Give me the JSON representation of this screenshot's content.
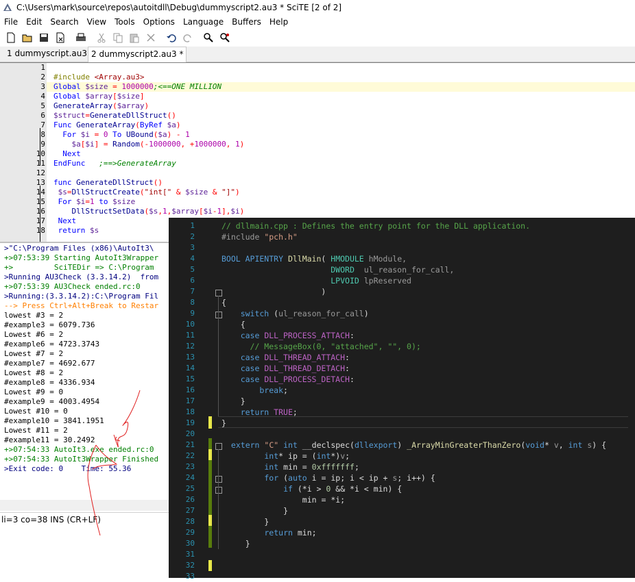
{
  "window": {
    "title": "C:\\Users\\mark\\source\\repos\\autoitdll\\Debug\\dummyscript2.au3 * SciTE [2 of 2]"
  },
  "menu": [
    "File",
    "Edit",
    "Search",
    "View",
    "Tools",
    "Options",
    "Language",
    "Buffers",
    "Help"
  ],
  "toolbar": [
    "new-file-icon",
    "open-folder-icon",
    "save-icon",
    "close-file-icon",
    "print-icon",
    "cut-icon",
    "copy-icon",
    "paste-icon",
    "delete-icon",
    "undo-icon",
    "redo-icon",
    "find-icon",
    "replace-icon"
  ],
  "tabs": [
    {
      "label": "1 dummyscript.au3 *"
    },
    {
      "label": "2 dummyscript2.au3 *"
    }
  ],
  "editor": {
    "line_numbers": [
      "1",
      "2",
      "3",
      "4",
      "5",
      "6",
      "7",
      "8",
      "9",
      "10",
      "11",
      "12",
      "13",
      "14",
      "15",
      "16",
      "17",
      "18"
    ],
    "lines": [
      [],
      [
        {
          "c": "mac",
          "t": "#include "
        },
        {
          "c": "str",
          "t": "<Array.au3>"
        }
      ],
      [
        {
          "c": "kw",
          "t": "Global "
        },
        {
          "c": "var",
          "t": "$size"
        },
        {
          "c": "op",
          "t": " = "
        },
        {
          "c": "num",
          "t": "1000000"
        },
        {
          "c": "cm",
          "t": ";<==ONE MILLION"
        }
      ],
      [
        {
          "c": "kw",
          "t": "Global "
        },
        {
          "c": "var",
          "t": "$array"
        },
        {
          "c": "op",
          "t": "["
        },
        {
          "c": "var",
          "t": "$size"
        },
        {
          "c": "op",
          "t": "]"
        }
      ],
      [
        {
          "c": "fn",
          "t": "GenerateArray"
        },
        {
          "c": "op",
          "t": "("
        },
        {
          "c": "var",
          "t": "$array"
        },
        {
          "c": "op",
          "t": ")"
        }
      ],
      [
        {
          "c": "var",
          "t": "$struct"
        },
        {
          "c": "op",
          "t": "="
        },
        {
          "c": "fn",
          "t": "GenerateDllStruct"
        },
        {
          "c": "op",
          "t": "()"
        }
      ],
      [
        {
          "c": "kw",
          "t": "Func "
        },
        {
          "c": "fn",
          "t": "GenerateArray"
        },
        {
          "c": "op",
          "t": "("
        },
        {
          "c": "kw",
          "t": "ByRef "
        },
        {
          "c": "var",
          "t": "$a"
        },
        {
          "c": "op",
          "t": ")"
        }
      ],
      [
        {
          "c": "kw",
          "t": "  For "
        },
        {
          "c": "var",
          "t": "$i"
        },
        {
          "c": "op",
          "t": " = "
        },
        {
          "c": "num",
          "t": "0"
        },
        {
          "c": "kw",
          "t": " To "
        },
        {
          "c": "fn",
          "t": "UBound"
        },
        {
          "c": "op",
          "t": "("
        },
        {
          "c": "var",
          "t": "$a"
        },
        {
          "c": "op",
          "t": ") - "
        },
        {
          "c": "num",
          "t": "1"
        }
      ],
      [
        {
          "c": "var",
          "t": "    $a"
        },
        {
          "c": "op",
          "t": "["
        },
        {
          "c": "var",
          "t": "$i"
        },
        {
          "c": "op",
          "t": "] = "
        },
        {
          "c": "fn",
          "t": "Random"
        },
        {
          "c": "op",
          "t": "(-"
        },
        {
          "c": "num",
          "t": "1000000"
        },
        {
          "c": "op",
          "t": ", +"
        },
        {
          "c": "num",
          "t": "1000000"
        },
        {
          "c": "op",
          "t": ", "
        },
        {
          "c": "num",
          "t": "1"
        },
        {
          "c": "op",
          "t": ")"
        }
      ],
      [
        {
          "c": "kw",
          "t": "  Next"
        }
      ],
      [
        {
          "c": "kw",
          "t": "EndFunc"
        },
        {
          "c": "cm",
          "t": "   ;==>GenerateArray"
        }
      ],
      [],
      [
        {
          "c": "kw",
          "t": "func "
        },
        {
          "c": "fn",
          "t": "GenerateDllStruct"
        },
        {
          "c": "op",
          "t": "()"
        }
      ],
      [
        {
          "c": "var",
          "t": " $s"
        },
        {
          "c": "op",
          "t": "="
        },
        {
          "c": "fn",
          "t": "DllStructCreate"
        },
        {
          "c": "op",
          "t": "("
        },
        {
          "c": "str",
          "t": "\"int[\""
        },
        {
          "c": "op",
          "t": " & "
        },
        {
          "c": "var",
          "t": "$size"
        },
        {
          "c": "op",
          "t": " & "
        },
        {
          "c": "str",
          "t": "\"]\""
        },
        {
          "c": "op",
          "t": ")"
        }
      ],
      [
        {
          "c": "kw",
          "t": " For "
        },
        {
          "c": "var",
          "t": "$i"
        },
        {
          "c": "op",
          "t": "="
        },
        {
          "c": "num",
          "t": "1"
        },
        {
          "c": "kw",
          "t": " to "
        },
        {
          "c": "var",
          "t": "$size"
        }
      ],
      [
        {
          "c": "fn",
          "t": "    DllStructSetData"
        },
        {
          "c": "op",
          "t": "("
        },
        {
          "c": "var",
          "t": "$s"
        },
        {
          "c": "op",
          "t": ","
        },
        {
          "c": "num",
          "t": "1"
        },
        {
          "c": "op",
          "t": ","
        },
        {
          "c": "var",
          "t": "$array"
        },
        {
          "c": "op",
          "t": "["
        },
        {
          "c": "var",
          "t": "$i"
        },
        {
          "c": "op",
          "t": "-"
        },
        {
          "c": "num",
          "t": "1"
        },
        {
          "c": "op",
          "t": "],"
        },
        {
          "c": "var",
          "t": "$i"
        },
        {
          "c": "op",
          "t": ")"
        }
      ],
      [
        {
          "c": "kw",
          "t": " Next"
        }
      ],
      [
        {
          "c": "kw",
          "t": " return "
        },
        {
          "c": "var",
          "t": "$s"
        }
      ]
    ]
  },
  "output": {
    "lines": [
      {
        "c": "#00007f",
        "t": ">\"C:\\Program Files (x86)\\AutoIt3\\"
      },
      {
        "c": "#007f00",
        "t": "+>07:53:39 Starting AutoIt3Wrapper"
      },
      {
        "c": "#007f00",
        "t": "+>         SciTEDir => C:\\Program"
      },
      {
        "c": "#00007f",
        "t": ">Running AU3Check (3.3.14.2)  from"
      },
      {
        "c": "#007f00",
        "t": "+>07:53:39 AU3Check ended.rc:0"
      },
      {
        "c": "#00007f",
        "t": ">Running:(3.3.14.2):C:\\Program Fil"
      },
      {
        "c": "#ff7f00",
        "t": "--> Press Ctrl+Alt+Break to Restar"
      },
      {
        "c": "#000000",
        "t": "lowest #3 = 2"
      },
      {
        "c": "#000000",
        "t": "#example3 = 6079.736"
      },
      {
        "c": "#000000",
        "t": "Lowest #6 = 2"
      },
      {
        "c": "#000000",
        "t": "#example6 = 4723.3743"
      },
      {
        "c": "#000000",
        "t": "Lowest #7 = 2"
      },
      {
        "c": "#000000",
        "t": "#example7 = 4692.677"
      },
      {
        "c": "#000000",
        "t": "Lowest #8 = 2"
      },
      {
        "c": "#000000",
        "t": "#example8 = 4336.934"
      },
      {
        "c": "#000000",
        "t": "Lowest #9 = 0"
      },
      {
        "c": "#000000",
        "t": "#example9 = 4003.4954"
      },
      {
        "c": "#000000",
        "t": "Lowest #10 = 0"
      },
      {
        "c": "#000000",
        "t": "#example10 = 3841.1951"
      },
      {
        "c": "#000000",
        "t": "Lowest #11 = 2"
      },
      {
        "c": "#000000",
        "t": "#example11 = 30.2492"
      },
      {
        "c": "#007f00",
        "t": "+>07:54:33 AutoIt3.exe ended.rc:0"
      },
      {
        "c": "#007f00",
        "t": "+>07:54:33 AutoIt3Wrapper Finished"
      },
      {
        "c": "#00007f",
        "t": ">Exit code: 0    Time: 55.36"
      }
    ],
    "right_fragments": [
      "La",
      "ap",
      "C2"
    ]
  },
  "status": {
    "text": "li=3 co=38 INS (CR+LF)"
  },
  "vs": {
    "line_numbers": [
      "1",
      "2",
      "3",
      "4",
      "5",
      "6",
      "7",
      "8",
      "9",
      "10",
      "11",
      "12",
      "13",
      "14",
      "15",
      "16",
      "17",
      "18",
      "19",
      "20",
      "21",
      "22",
      "23",
      "24",
      "25",
      "26",
      "27",
      "28",
      "29",
      "30",
      "31",
      "32",
      "33"
    ],
    "lines": [
      [
        {
          "c": "vcm",
          "t": "// dllmain.cpp : Defines the entry point for the DLL application."
        }
      ],
      [
        {
          "c": "vpp",
          "t": "#include "
        },
        {
          "c": "vstr",
          "t": "\"pch.h\""
        }
      ],
      [],
      [
        {
          "c": "vkw",
          "t": "BOOL APIENTRY "
        },
        {
          "c": "vfn",
          "t": "DllMain"
        },
        {
          "c": "",
          "t": "( "
        },
        {
          "c": "vty",
          "t": "HMODULE"
        },
        {
          "c": "vprm",
          "t": " hModule,"
        }
      ],
      [
        {
          "c": "",
          "t": "                       "
        },
        {
          "c": "vty",
          "t": "DWORD"
        },
        {
          "c": "vprm",
          "t": "  ul_reason_for_call,"
        }
      ],
      [
        {
          "c": "",
          "t": "                       "
        },
        {
          "c": "vty",
          "t": "LPVOID"
        },
        {
          "c": "vprm",
          "t": " lpReserved"
        }
      ],
      [
        {
          "c": "",
          "t": "                     )"
        }
      ],
      [
        {
          "c": "",
          "t": "{"
        }
      ],
      [
        {
          "c": "vkw",
          "t": "    switch "
        },
        {
          "c": "",
          "t": "("
        },
        {
          "c": "vprm",
          "t": "ul_reason_for_call"
        },
        {
          "c": "",
          "t": ")"
        }
      ],
      [
        {
          "c": "",
          "t": "    {"
        }
      ],
      [
        {
          "c": "vkw",
          "t": "    case "
        },
        {
          "c": "vmac",
          "t": "DLL_PROCESS_ATTACH"
        },
        {
          "c": "",
          "t": ":"
        }
      ],
      [
        {
          "c": "vcm",
          "t": "      // MessageBox(0, \"attached\", \"\", 0);"
        }
      ],
      [
        {
          "c": "vkw",
          "t": "    case "
        },
        {
          "c": "vmac",
          "t": "DLL_THREAD_ATTACH"
        },
        {
          "c": "",
          "t": ":"
        }
      ],
      [
        {
          "c": "vkw",
          "t": "    case "
        },
        {
          "c": "vmac",
          "t": "DLL_THREAD_DETACH"
        },
        {
          "c": "",
          "t": ":"
        }
      ],
      [
        {
          "c": "vkw",
          "t": "    case "
        },
        {
          "c": "vmac",
          "t": "DLL_PROCESS_DETACH"
        },
        {
          "c": "",
          "t": ":"
        }
      ],
      [
        {
          "c": "vkw",
          "t": "        break"
        },
        {
          "c": "",
          "t": ";"
        }
      ],
      [
        {
          "c": "",
          "t": "    }"
        }
      ],
      [
        {
          "c": "vkw",
          "t": "    return "
        },
        {
          "c": "vmac",
          "t": "TRUE"
        },
        {
          "c": "",
          "t": ";"
        }
      ],
      [
        {
          "c": "",
          "t": "}"
        }
      ],
      [],
      [
        {
          "c": "vkw",
          "t": " extern "
        },
        {
          "c": "vstr",
          "t": "\"C\""
        },
        {
          "c": "vkw",
          "t": " int "
        },
        {
          "c": "",
          "t": "__declspec("
        },
        {
          "c": "vkw",
          "t": "dllexport"
        },
        {
          "c": "",
          "t": ") "
        },
        {
          "c": "vfn",
          "t": "_ArrayMinGreaterThanZero"
        },
        {
          "c": "",
          "t": "("
        },
        {
          "c": "vkw",
          "t": "void"
        },
        {
          "c": "",
          "t": "* "
        },
        {
          "c": "vprm",
          "t": "v"
        },
        {
          "c": "",
          "t": ", "
        },
        {
          "c": "vkw",
          "t": "int "
        },
        {
          "c": "vprm",
          "t": "s"
        },
        {
          "c": "",
          "t": ") {"
        }
      ],
      [
        {
          "c": "vkw",
          "t": "        int"
        },
        {
          "c": "",
          "t": "* ip = ("
        },
        {
          "c": "vkw",
          "t": "int"
        },
        {
          "c": "",
          "t": "*)"
        },
        {
          "c": "vprm",
          "t": "v"
        },
        {
          "c": "",
          "t": ";"
        }
      ],
      [
        {
          "c": "vkw",
          "t": "        int "
        },
        {
          "c": "",
          "t": "min = "
        },
        {
          "c": "vnum",
          "t": "0xfffffff"
        },
        {
          "c": "",
          "t": ";"
        }
      ],
      [
        {
          "c": "vkw",
          "t": "        for "
        },
        {
          "c": "",
          "t": "("
        },
        {
          "c": "vkw",
          "t": "auto "
        },
        {
          "c": "",
          "t": "i = ip; i < ip + "
        },
        {
          "c": "vprm",
          "t": "s"
        },
        {
          "c": "",
          "t": "; i++) {"
        }
      ],
      [
        {
          "c": "vkw",
          "t": "            if "
        },
        {
          "c": "",
          "t": "(*i > "
        },
        {
          "c": "vnum",
          "t": "0"
        },
        {
          "c": "",
          "t": " && *i < min) {"
        }
      ],
      [
        {
          "c": "",
          "t": "                min = *i;"
        }
      ],
      [
        {
          "c": "",
          "t": "            }"
        }
      ],
      [
        {
          "c": "",
          "t": "        }"
        }
      ],
      [
        {
          "c": "vkw",
          "t": "        return "
        },
        {
          "c": "",
          "t": "min;"
        }
      ],
      [
        {
          "c": "",
          "t": "    }"
        }
      ],
      [],
      [],
      []
    ]
  }
}
